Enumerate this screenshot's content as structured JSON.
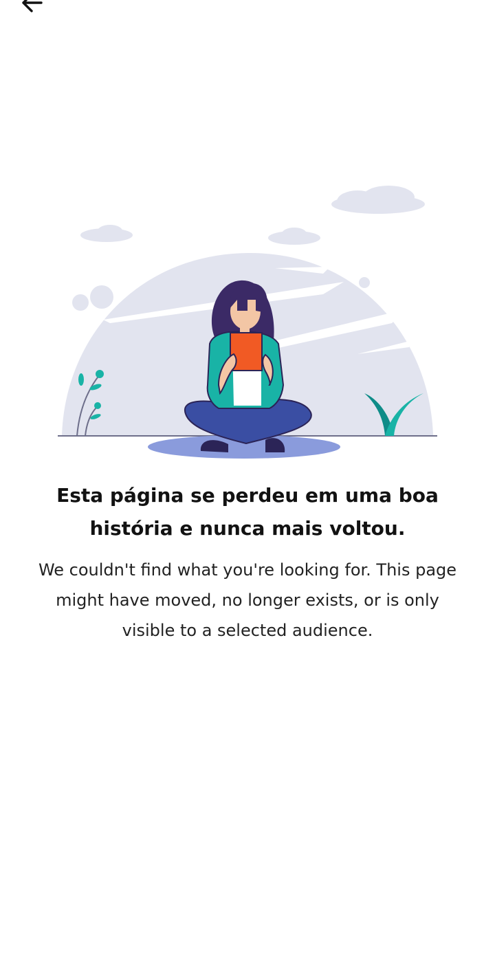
{
  "header": {
    "back_icon": "arrow-left-icon"
  },
  "illustration": {
    "name": "woman-reading-book-illustration",
    "colors": {
      "background_shape": "#e2e4ef",
      "ground_shadow": "#8a9bdc",
      "book": "#f15a24",
      "jacket": "#19b3a6",
      "pants": "#3a4ea3",
      "hair": "#3b2a66",
      "skin": "#f3c6a5",
      "plant": "#19b3a6"
    }
  },
  "error": {
    "title": "Esta página se perdeu em uma boa história e nunca mais voltou.",
    "message": "We couldn't find what you're looking for. This page might have moved, no longer exists, or is only visible to a selected audience."
  }
}
